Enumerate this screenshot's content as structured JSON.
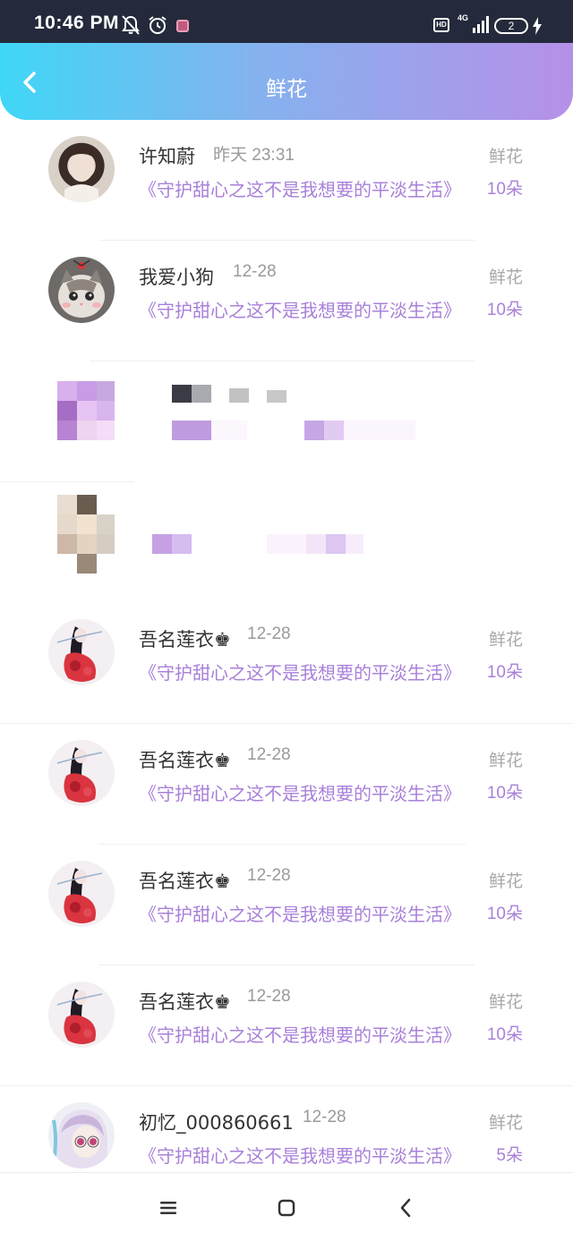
{
  "status_bar": {
    "time": "10:46 PM",
    "hd": "HD",
    "network": "4G",
    "battery": "2"
  },
  "header": {
    "title": "鲜花"
  },
  "list": [
    {
      "name": "许知蔚",
      "time": "昨天 23:31",
      "gift": "鲜花",
      "book": "《守护甜心之这不是我想要的平淡生活》",
      "count": "10朵",
      "avatar": "woman-avatar"
    },
    {
      "name": "我爱小狗",
      "time": "12-28",
      "gift": "鲜花",
      "book": "《守护甜心之这不是我想要的平淡生活》",
      "count": "10朵",
      "avatar": "cat-avatar"
    },
    {
      "name": "吾名莲衣♚",
      "time": "12-28",
      "gift": "鲜花",
      "book": "《守护甜心之这不是我想要的平淡生活》",
      "count": "10朵",
      "avatar": "anime-girl-avatar"
    },
    {
      "name": "吾名莲衣♚",
      "time": "12-28",
      "gift": "鲜花",
      "book": "《守护甜心之这不是我想要的平淡生活》",
      "count": "10朵",
      "avatar": "anime-girl-avatar"
    },
    {
      "name": "吾名莲衣♚",
      "time": "12-28",
      "gift": "鲜花",
      "book": "《守护甜心之这不是我想要的平淡生活》",
      "count": "10朵",
      "avatar": "anime-girl-avatar"
    },
    {
      "name": "吾名莲衣♚",
      "time": "12-28",
      "gift": "鲜花",
      "book": "《守护甜心之这不是我想要的平淡生活》",
      "count": "10朵",
      "avatar": "anime-girl-avatar"
    },
    {
      "name": "初忆_000860661",
      "time": "12-28",
      "gift": "鲜花",
      "book": "《守护甜心之这不是我想要的平淡生活》",
      "count": "5朵",
      "avatar": "anime-girl-glasses-avatar"
    }
  ],
  "colors": {
    "accent": "#a880d9",
    "header_start": "#3fd7f6",
    "header_end": "#b690e8"
  }
}
